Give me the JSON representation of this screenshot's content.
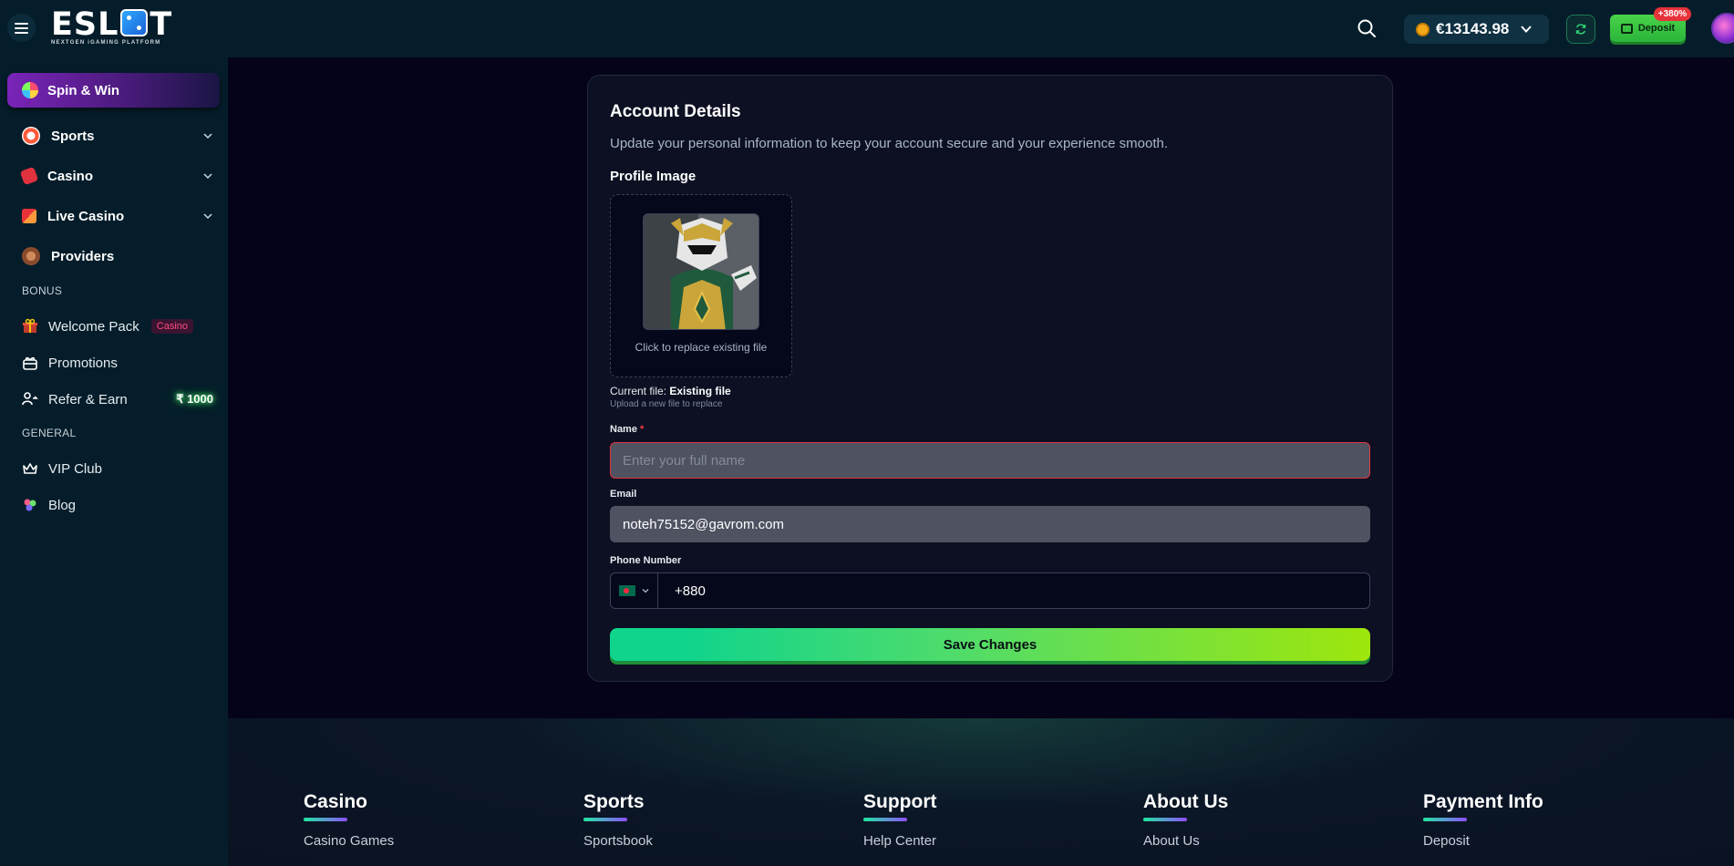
{
  "header": {
    "logo_text_left": "ESL",
    "logo_text_right": "T",
    "logo_tagline": "NEXTGEN iGAMING PLATFORM",
    "balance": "€13143.98",
    "deposit_label": "Deposit",
    "deposit_badge": "+380%"
  },
  "sidebar": {
    "spin_win": "Spin & Win",
    "nav": [
      {
        "label": "Sports",
        "icon": "sports-icon"
      },
      {
        "label": "Casino",
        "icon": "casino-icon"
      },
      {
        "label": "Live Casino",
        "icon": "live-casino-icon"
      },
      {
        "label": "Providers",
        "icon": "providers-icon"
      }
    ],
    "bonus_title": "BONUS",
    "bonus_items": [
      {
        "label": "Welcome Pack",
        "badge": "Casino",
        "icon": "gift-icon"
      },
      {
        "label": "Promotions",
        "icon": "promotions-icon"
      },
      {
        "label": "Refer & Earn",
        "amount": "₹ 1000",
        "icon": "refer-icon"
      }
    ],
    "general_title": "GENERAL",
    "general_items": [
      {
        "label": "VIP Club",
        "icon": "crown-icon"
      },
      {
        "label": "Blog",
        "icon": "blog-icon"
      }
    ]
  },
  "account": {
    "title": "Account Details",
    "subtitle": "Update your personal information to keep your account secure and your experience smooth.",
    "profile_image_label": "Profile Image",
    "upload_hint": "Click to replace existing file",
    "current_file_prefix": "Current file:",
    "current_file_name": "Existing file",
    "upload_note": "Upload a new file to replace",
    "name_label": "Name",
    "name_required": "*",
    "name_placeholder": "Enter your full name",
    "name_value": "",
    "email_label": "Email",
    "email_value": "noteh75152@gavrom.com",
    "phone_label": "Phone Number",
    "phone_value": "+880",
    "save_label": "Save Changes"
  },
  "footer": {
    "columns": [
      {
        "title": "Casino",
        "link": "Casino Games"
      },
      {
        "title": "Sports",
        "link": "Sportsbook"
      },
      {
        "title": "Support",
        "link": "Help Center"
      },
      {
        "title": "About Us",
        "link": "About Us"
      },
      {
        "title": "Payment Info",
        "link": "Deposit"
      }
    ]
  },
  "colors": {
    "accent_green": "#2bb53a",
    "error_red": "#e4343f",
    "sidebar_bg": "#051d2a",
    "main_bg": "#05031a"
  }
}
